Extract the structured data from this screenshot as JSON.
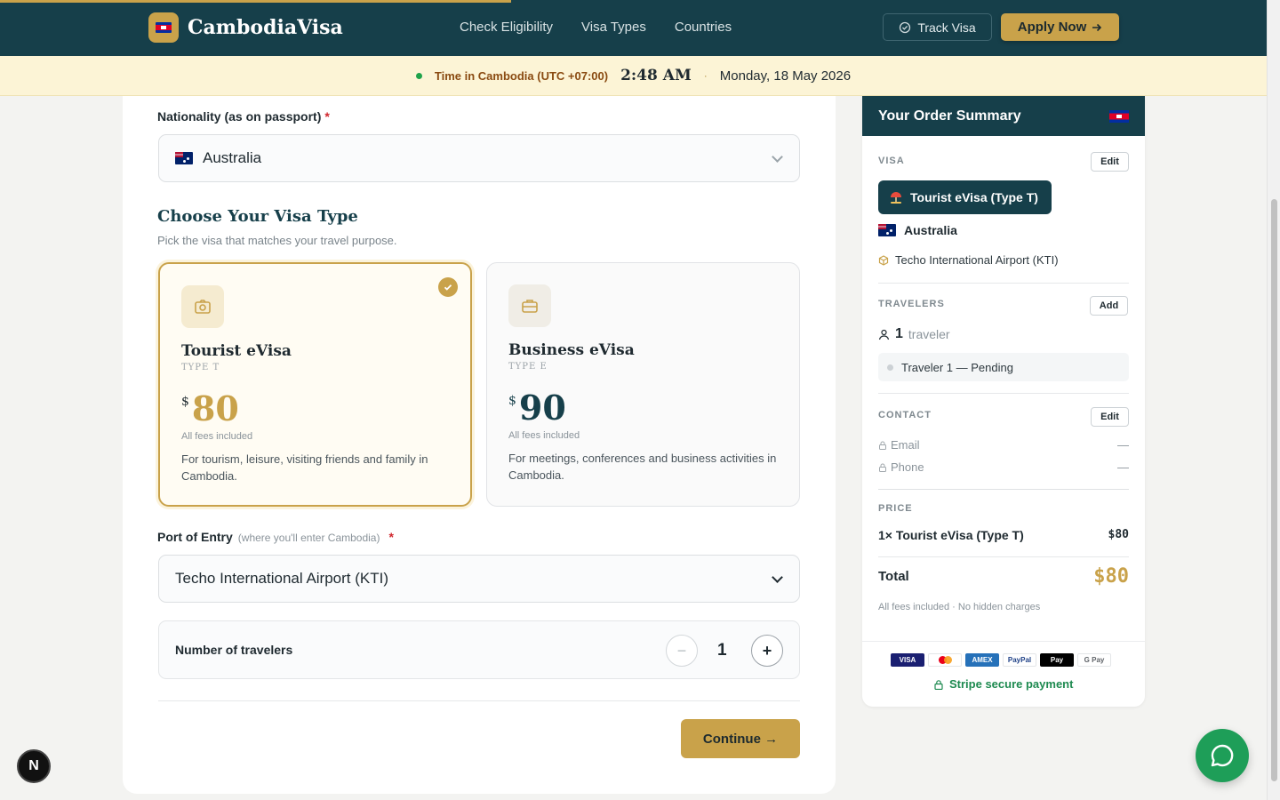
{
  "header": {
    "brand": "CambodiaVisa",
    "nav": [
      "Check Eligibility",
      "Visa Types",
      "Countries"
    ],
    "track_label": "Track Visa",
    "apply_label": "Apply Now"
  },
  "timebar": {
    "label": "Time in Cambodia (UTC +07:00)",
    "time": "2:48 AM",
    "separator": "·",
    "date": "Monday, 18 May 2026"
  },
  "form": {
    "nationality_label": "Nationality (as on passport)",
    "required_mark": "*",
    "nationality_value": "Australia",
    "visa_section_title": "Choose Your Visa Type",
    "visa_section_sub": "Pick the visa that matches your travel purpose.",
    "visa_options": [
      {
        "name": "Tourist eVisa",
        "type": "TYPE T",
        "currency": "$",
        "price": "80",
        "fees": "All fees included",
        "desc": "For tourism, leisure, visiting friends and family in Cambodia.",
        "selected": true
      },
      {
        "name": "Business eVisa",
        "type": "TYPE E",
        "currency": "$",
        "price": "90",
        "fees": "All fees included",
        "desc": "For meetings, conferences and business activities in Cambodia.",
        "selected": false
      }
    ],
    "port_label": "Port of Entry",
    "port_hint": "(where you'll enter Cambodia)",
    "port_value": "Techo International Airport (KTI)",
    "travelers_label": "Number of travelers",
    "travelers_minus": "−",
    "travelers_value": "1",
    "travelers_plus": "+",
    "continue_label": "Continue →"
  },
  "summary": {
    "title": "Your Order Summary",
    "visa_label": "VISA",
    "edit_label": "Edit",
    "visa_pill": "Tourist eVisa (Type T)",
    "country": "Australia",
    "port": "Techo International Airport (KTI)",
    "travelers_label": "TRAVELERS",
    "add_label": "Add",
    "traveler_count": "1",
    "traveler_word": "traveler",
    "traveler_item": "Traveler 1 — Pending",
    "contact_label": "CONTACT",
    "email_label": "Email",
    "email_value": "—",
    "phone_label": "Phone",
    "phone_value": "—",
    "price_label": "PRICE",
    "line_item": "1× Tourist eVisa (Type T)",
    "line_price": "$80",
    "total_label": "Total",
    "total_value": "$80",
    "fees_note": "All fees included · No hidden charges",
    "payment_logos": [
      "VISA",
      "",
      "AMEX",
      "PayPal",
      " Pay",
      "G Pay"
    ],
    "secure_label": "Stripe secure payment"
  },
  "misc": {
    "n_badge": "N"
  },
  "colors": {
    "primary": "#163f4a",
    "accent": "#c9a24a",
    "success": "#1e9e58"
  }
}
